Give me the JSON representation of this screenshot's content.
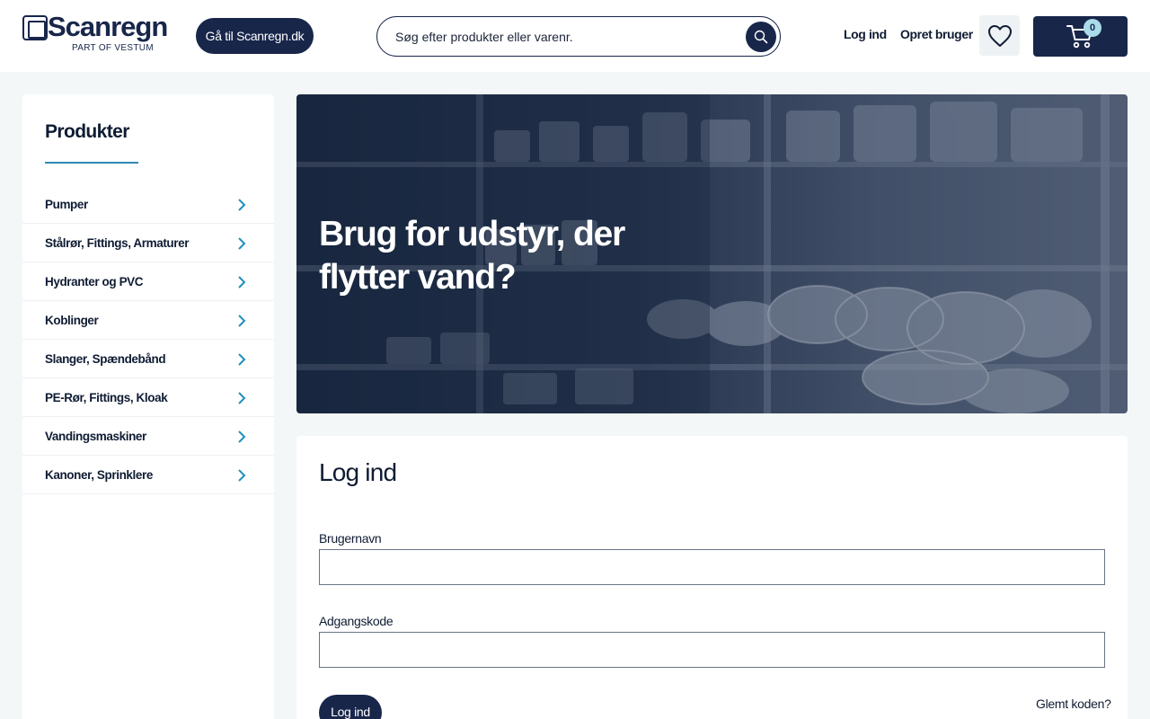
{
  "header": {
    "logo_text": "Scanregn",
    "logo_sub": "PART OF VESTUM",
    "goto_label": "Gå til Scanregn.dk",
    "search_placeholder": "Søg efter produkter eller varenr.",
    "login_link": "Log ind",
    "register_link": "Opret bruger",
    "cart_count": "0"
  },
  "sidebar": {
    "title": "Produkter",
    "items": [
      {
        "label": "Pumper"
      },
      {
        "label": "Stålrør, Fittings, Armaturer"
      },
      {
        "label": "Hydranter og PVC"
      },
      {
        "label": "Koblinger"
      },
      {
        "label": "Slanger, Spændebånd"
      },
      {
        "label": "PE-Rør, Fittings, Kloak"
      },
      {
        "label": "Vandingsmaskiner"
      },
      {
        "label": "Kanoner, Sprinklere"
      }
    ]
  },
  "hero": {
    "line1": "Brug for udstyr, der",
    "line2": "flytter vand?"
  },
  "login": {
    "title": "Log ind",
    "username_label": "Brugernavn",
    "username_value": "",
    "password_label": "Adgangskode",
    "password_value": "",
    "submit_label": "Log ind",
    "forgot_label": "Glemt koden?"
  },
  "colors": {
    "primary": "#18264a",
    "accent": "#2e8ab5",
    "chevron": "#1f8fbf",
    "page_bg": "#f3f7f7",
    "badge": "#a9dbe9"
  },
  "icons": [
    "search-icon",
    "heart-icon",
    "cart-icon",
    "chevron-right-icon"
  ]
}
